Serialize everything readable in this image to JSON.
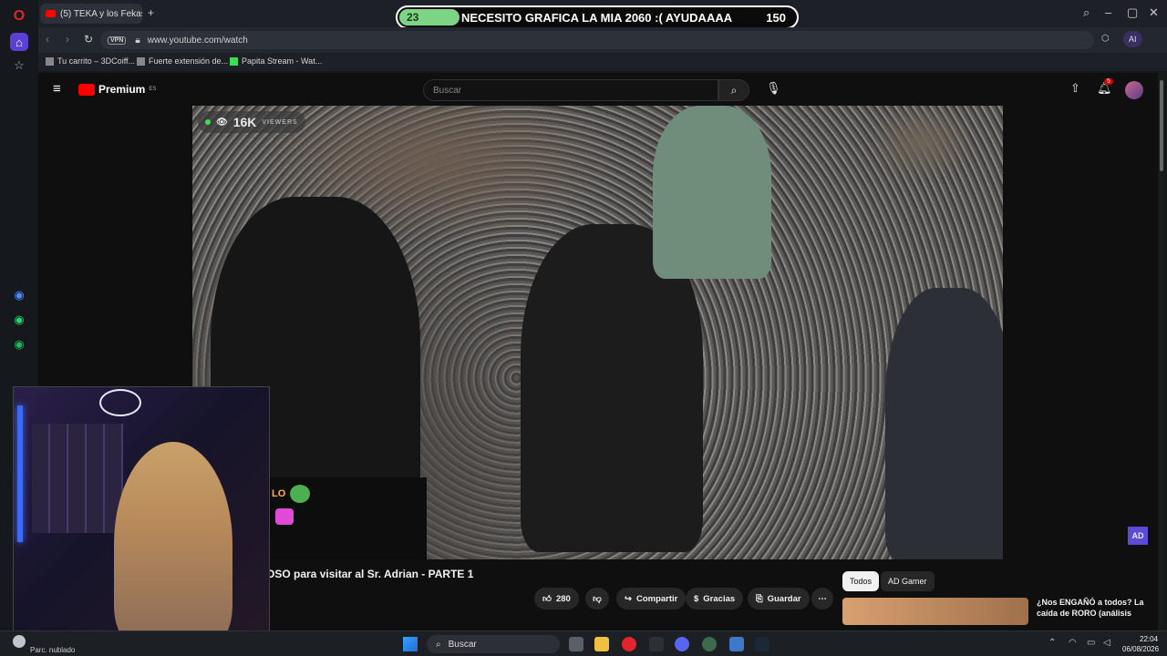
{
  "browser": {
    "tab_title": "(5) TEKA y los Fekas v",
    "url": "www.youtube.com/watch",
    "vpn_label": "VPN",
    "ai_label": "AI",
    "bookmarks": [
      "Tu carrito – 3DCoiff...",
      "Fuerte extensión de...",
      "Papita Stream - Wat..."
    ]
  },
  "goal_bar": {
    "current": "23",
    "text": "NECESITO GRAFICA LA MIA 2060 :( AYUDAAAA",
    "target": "150",
    "progress": 0.153
  },
  "youtube": {
    "logo": "Premium",
    "region": "ES",
    "search_placeholder": "Buscar",
    "notification_count": "5",
    "viewer_count": "16K",
    "viewer_label": "VIEWERS",
    "video_title": "OSO para visitar al Sr. Adrian - PARTE 1",
    "likes": "280",
    "share_label": "Compartir",
    "thanks_label": "Gracias",
    "save_label": "Guardar",
    "chips": [
      "Todos",
      "AD Gamer"
    ],
    "rec_title_1": "¿Nos ENGAÑÓ a todos? La",
    "rec_title_2": "caída de RORO (análisis",
    "channel_badge": "AD"
  },
  "chat_overlay": {
    "text": "LO"
  },
  "taskbar": {
    "weather": "Parc. nublado",
    "search": "Buscar",
    "time": "22:04",
    "date": "06/08/2026"
  },
  "colors": {
    "yt_red": "#ff0000",
    "goal_green": "#7ed485",
    "live_green": "#3ddc52",
    "opera_red": "#e0252b"
  }
}
